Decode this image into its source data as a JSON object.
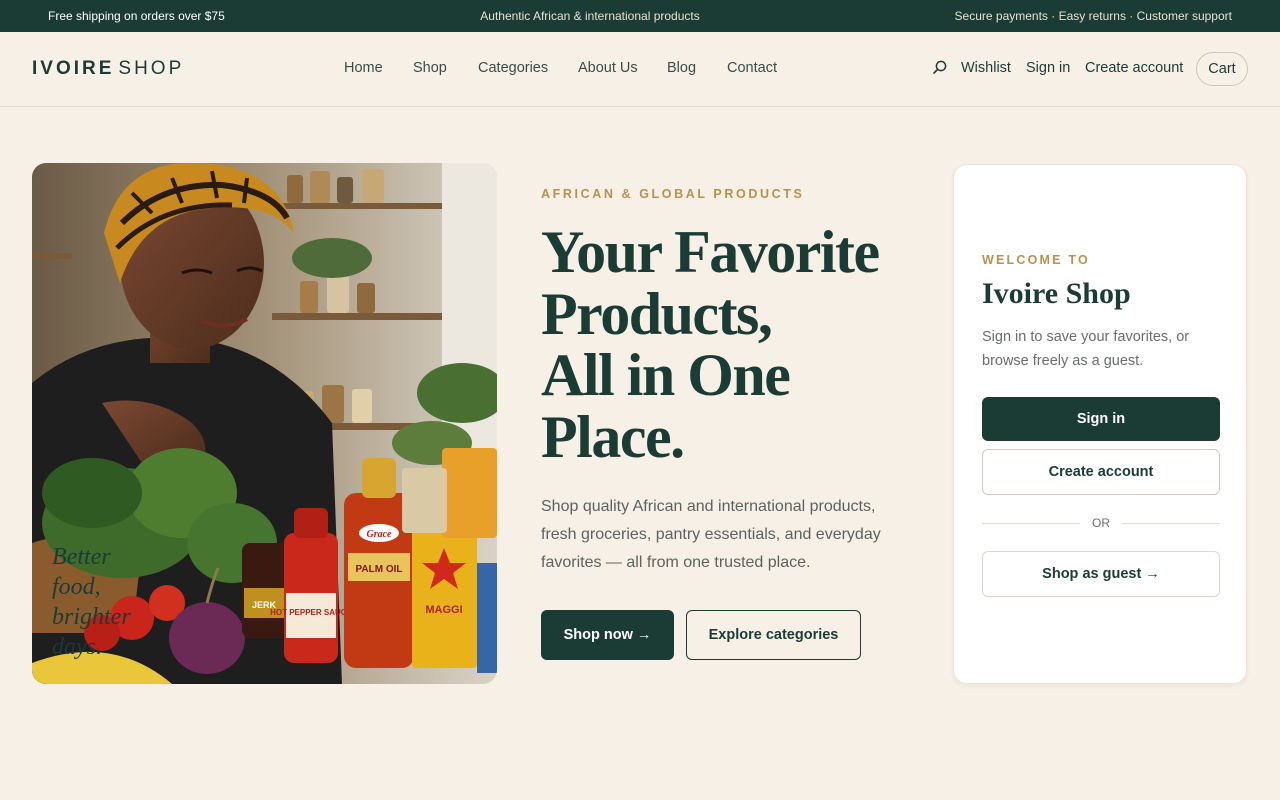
{
  "topbar": {
    "left": "Free shipping on orders over $75",
    "center": "Authentic African & international products",
    "right": "Secure payments · Easy returns · Customer support"
  },
  "header": {
    "logo_strong": "IVOIRE",
    "logo_light": "SHOP",
    "nav": [
      "Home",
      "Shop",
      "Categories",
      "About Us",
      "Blog",
      "Contact"
    ],
    "search_icon": "search-icon",
    "wishlist": "Wishlist",
    "signin": "Sign in",
    "create_account": "Create account",
    "cart": "Cart"
  },
  "hero": {
    "image_tagline": [
      "Better",
      "food,",
      "brighter",
      "days."
    ],
    "eyebrow": "AFRICAN & GLOBAL PRODUCTS",
    "title_lines": [
      "Your Favorite",
      "Products,",
      "All in One",
      "Place."
    ],
    "description": "Shop quality African and international products, fresh groceries, pantry essentials, and everyday favorites — all from one trusted place.",
    "primary_cta": "Shop now →",
    "secondary_cta": "Explore categories"
  },
  "card": {
    "eyebrow": "WELCOME TO",
    "title": "Ivoire Shop",
    "description": "Sign in to save your favorites, or browse freely as a guest.",
    "signin": "Sign in",
    "create_account": "Create account",
    "divider": "OR",
    "guest": "Shop as guest →"
  },
  "product_labels": [
    "Grace",
    "JERK",
    "HOT PEPPER SAUCE",
    "PALM OIL",
    "MAGGI"
  ],
  "colors": {
    "brand": "#1b3b35",
    "accent": "#b8924d",
    "background": "#f6f0e7",
    "card": "#ffffff"
  }
}
